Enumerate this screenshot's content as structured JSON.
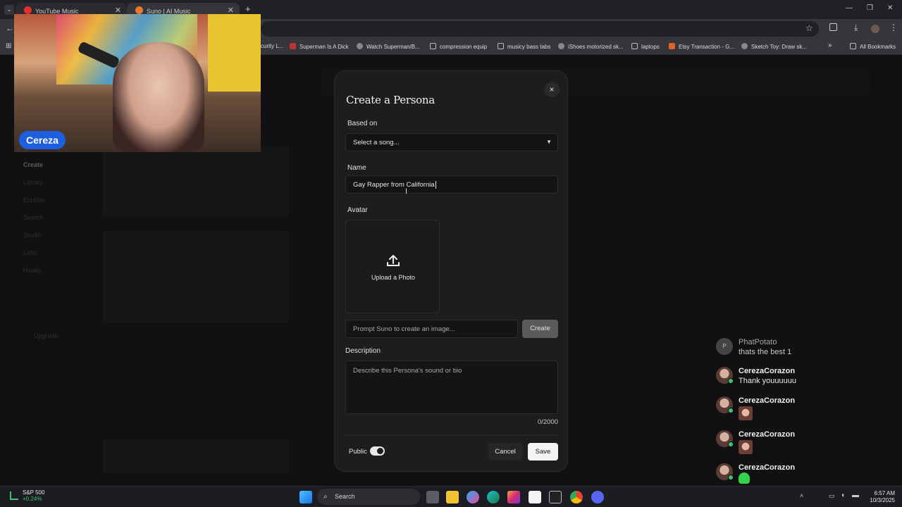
{
  "browser": {
    "tabs": [
      {
        "label": "YouTube Music",
        "active": false
      },
      {
        "label": "Suno | AI Music",
        "active": true
      }
    ],
    "new_tab": "+",
    "bookmarks": [
      {
        "label": "curity L...",
        "icon": "page-icon"
      },
      {
        "label": "Superman Is A Dick",
        "icon": "video-icon"
      },
      {
        "label": "Watch Superman/B...",
        "icon": "globe-icon"
      },
      {
        "label": "compression equip",
        "icon": "folder-icon"
      },
      {
        "label": "musicy bass tabs",
        "icon": "folder-icon"
      },
      {
        "label": "iShoes motorized sk...",
        "icon": "globe-icon"
      },
      {
        "label": "laptops",
        "icon": "folder-icon"
      },
      {
        "label": "Etsy Transaction - G...",
        "icon": "etsy-icon"
      },
      {
        "label": "Sketch Toy: Draw sk...",
        "icon": "globe-icon"
      }
    ],
    "more_bookmarks": "»",
    "all_bookmarks": "All Bookmarks"
  },
  "webcam": {
    "streamer_name": "Cereza"
  },
  "background": {
    "sidebar": [
      "Create",
      "Library",
      "Explore",
      "Search",
      "Studio",
      "Labs",
      "Hooks"
    ],
    "upgrade": "Upgrade"
  },
  "modal": {
    "title": "Create a Persona",
    "close_symbol": "×",
    "based_on_label": "Based on",
    "song_select": "Select a song...",
    "name_label": "Name",
    "name_value": "Gay Rapper from California",
    "avatar_label": "Avatar",
    "upload_label": "Upload a Photo",
    "prompt_placeholder": "Prompt Suno to create an image...",
    "create_button": "Create",
    "description_label": "Description",
    "description_placeholder": "Describe this Persona's sound or bio",
    "char_count": "0/2000",
    "public_label": "Public",
    "public_enabled": true,
    "cancel_button": "Cancel",
    "save_button": "Save"
  },
  "chat": [
    {
      "user": "PhatPotato",
      "message": "thats the best 1",
      "muted": true
    },
    {
      "user": "CerezaCorazon",
      "message": "Thank youuuuuu"
    },
    {
      "user": "CerezaCorazon",
      "emote": "emote-face"
    },
    {
      "user": "CerezaCorazon",
      "emote": "emote-face"
    },
    {
      "user": "CerezaCorazon",
      "emote": "emote-green"
    }
  ],
  "taskbar": {
    "stock_name": "S&P 500",
    "stock_change": "+0.24%",
    "search_placeholder": "Search",
    "time": "6:57 AM",
    "date": "10/3/2025"
  }
}
